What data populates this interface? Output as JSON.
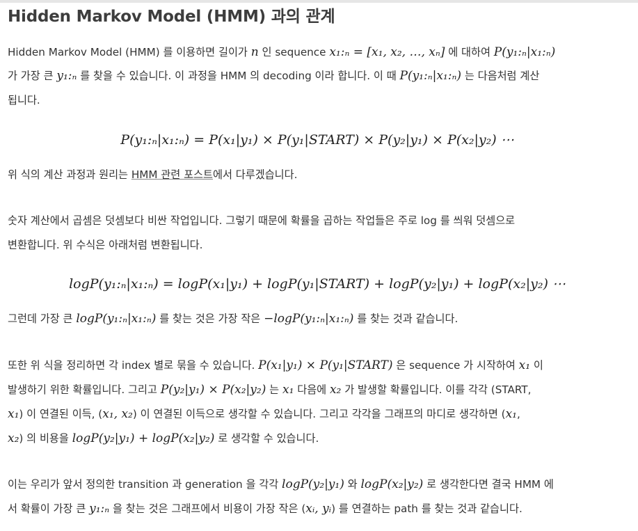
{
  "title": "Hidden Markov Model (HMM) 과의 관계",
  "paragraphs": {
    "p1_l1_a": "Hidden Markov Model (HMM) 를 이용하면 길이가 ",
    "p1_l1_m1": "n",
    "p1_l1_b": " 인 sequence ",
    "p1_l1_m2": "x₁:ₙ = [x₁, x₂, …, xₙ]",
    "p1_l1_c": " 에 대하여 ",
    "p1_l1_m3": "P(y₁:ₙ|x₁:ₙ)",
    "p1_l2_a": "가 가장 큰 ",
    "p1_l2_m1": "y₁:ₙ",
    "p1_l2_b": " 를 찾을 수 있습니다. 이 과정을 HMM 의 decoding 이라 합니다. 이 때 ",
    "p1_l2_m2": "P(y₁:ₙ|x₁:ₙ)",
    "p1_l2_c": " 는 다음처럼 계산",
    "p1_l3": "됩니다.",
    "eq1": "P(y₁:ₙ|x₁:ₙ) = P(x₁|y₁) × P(y₁|START) × P(y₂|y₁) × P(x₂|y₂) ⋯",
    "p2_a": "위 식의 계산 과정과 원리는 ",
    "p2_link": "HMM 관련 포스트",
    "p2_b": "에서 다루겠습니다.",
    "p3_l1": "숫자 계산에서 곱셈은 덧셈보다 비싼 작업입니다. 그렇기 때문에 확률을 곱하는 작업들은 주로 log 를 씌워 덧셈으로",
    "p3_l2": "변환합니다. 위 수식은 아래처럼 변환됩니다.",
    "eq2": "logP(y₁:ₙ|x₁:ₙ) = logP(x₁|y₁) + logP(y₁|START) + logP(y₂|y₁) + logP(x₂|y₂) ⋯",
    "p4_a": "그런데 가장 큰 ",
    "p4_m1": "logP(y₁:ₙ|x₁:ₙ)",
    "p4_b": " 를 찾는 것은 가장 작은 ",
    "p4_m2": "−logP(y₁:ₙ|x₁:ₙ)",
    "p4_c": " 를 찾는 것과 같습니다.",
    "p5_l1_a": "또한 위 식을 정리하면 각 index 별로 묶을 수 있습니다. ",
    "p5_l1_m1": "P(x₁|y₁) × P(y₁|START)",
    "p5_l1_b": " 은 sequence 가 시작하여 ",
    "p5_l1_m2": "x₁",
    "p5_l1_c": " 이",
    "p5_l2_a": "발생하기 위한 확률입니다. 그리고 ",
    "p5_l2_m1": "P(y₂|y₁) × P(x₂|y₂)",
    "p5_l2_b": " 는 ",
    "p5_l2_m2": "x₁",
    "p5_l2_c": " 다음에 ",
    "p5_l2_m3": "x₂",
    "p5_l2_d": " 가 발생할 확률입니다. 이를 각각 (START,",
    "p5_l3_m1": "x₁",
    "p5_l3_a": ") 이 연결된 이득, (",
    "p5_l3_m2": "x₁, x₂",
    "p5_l3_b": ") 이 연결된 이득으로 생각할 수 있습니다. 그리고 각각을 그래프의 마디로 생각하면 (",
    "p5_l3_m3": "x₁",
    "p5_l3_c": ",",
    "p5_l4_m1": "x₂",
    "p5_l4_a": ") 의 비용을 ",
    "p5_l4_m2": "logP(y₂|y₁) + logP(x₂|y₂)",
    "p5_l4_b": " 로 생각할 수 있습니다.",
    "p6_l1_a": "이는 우리가 앞서 정의한 transition 과 generation 을 각각 ",
    "p6_l1_m1": "logP(y₂|y₁)",
    "p6_l1_b": " 와 ",
    "p6_l1_m2": "logP(x₂|y₂)",
    "p6_l1_c": " 로 생각한다면 결국 HMM 에",
    "p6_l2_a": "서 확률이 가장 큰 ",
    "p6_l2_m1": "y₁:ₙ",
    "p6_l2_b": " 을 찾는 것은 그래프에서 비용이 가장 작은 (",
    "p6_l2_m2": "xᵢ, yᵢ",
    "p6_l2_c": ") 를 연결하는 path 를 찾는 것과 같습니다."
  }
}
